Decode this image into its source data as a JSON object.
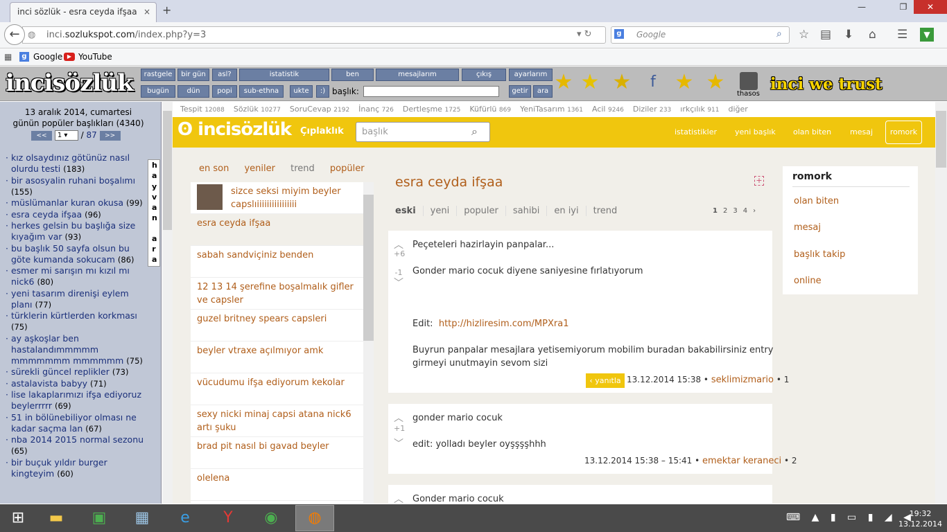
{
  "browser": {
    "tab_title": "inci sözlük - esra ceyda ifşaa",
    "tab_close": "×",
    "new_tab": "+",
    "url_prefix": "inci.",
    "url_domain": "sozlukspot.com",
    "url_path": "/index.php?y=3",
    "search_placeholder": "Google",
    "bookmarks": [
      "Google",
      "YouTube"
    ]
  },
  "site_header": {
    "logo": "incisözlük",
    "row1": [
      "rastgele",
      "bir gün",
      "asl?",
      "istatistik",
      "ben",
      "mesajlarım",
      "çıkış",
      "ayarlarım"
    ],
    "row2": [
      "bugün",
      "dün",
      "popi",
      "sub-ethna",
      "ukte",
      ":)"
    ],
    "baslik_label": "başlık:",
    "getir": "getir",
    "ara": "ara",
    "user": "thasos",
    "slogan": "inci we trust"
  },
  "sidebar": {
    "date": "13 aralık 2014, cumartesi",
    "popular": "günün popüler başlıkları (4340)",
    "prev": "<<",
    "page": "1",
    "sep": "/",
    "total": "87",
    "next": ">>",
    "vertical1": "h a y v a n",
    "vertical2": "a r a",
    "topics": [
      {
        "t": "kız olsaydınız götünüz nasıl olurdu testi",
        "c": "(183)"
      },
      {
        "t": "bir asosyalin ruhani boşalımı",
        "c": "(155)"
      },
      {
        "t": "müslümanlar kuran okusa",
        "c": "(99)"
      },
      {
        "t": "esra ceyda ifşaa",
        "c": "(96)"
      },
      {
        "t": "herkes gelsin bu başlığa size kıyağım var",
        "c": "(93)"
      },
      {
        "t": "bu başlık 50 sayfa olsun bu göte kumanda sokucam",
        "c": "(86)"
      },
      {
        "t": "esmer mi sarışın mı kızıl mı nick6",
        "c": "(80)"
      },
      {
        "t": "yeni tasarım direnişi eylem planı",
        "c": "(77)"
      },
      {
        "t": "türklerin kürtlerden korkması",
        "c": "(75)"
      },
      {
        "t": "ay aşkoşlar ben hastalandımmmmm mmmmmmm mmmmmm",
        "c": "(75)"
      },
      {
        "t": "sürekli güncel replikler",
        "c": "(73)"
      },
      {
        "t": "astalavista babyy",
        "c": "(71)"
      },
      {
        "t": "lise lakaplarımızı ifşa ediyoruz beylerrrrr",
        "c": "(69)"
      },
      {
        "t": "51 in bölünebiliyor olması ne kadar saçma lan",
        "c": "(67)"
      },
      {
        "t": "nba 2014 2015 normal sezonu",
        "c": "(65)"
      },
      {
        "t": "bir buçuk yıldır burger kingteyim",
        "c": "(60)"
      }
    ]
  },
  "categories": [
    {
      "n": "Tespit",
      "c": "12088"
    },
    {
      "n": "Sözlük",
      "c": "10277"
    },
    {
      "n": "SoruCevap",
      "c": "2192"
    },
    {
      "n": "İnanç",
      "c": "726"
    },
    {
      "n": "Dertleşme",
      "c": "1725"
    },
    {
      "n": "Küfürlü",
      "c": "869"
    },
    {
      "n": "YeniTasarım",
      "c": "1361"
    },
    {
      "n": "Acil",
      "c": "9246"
    },
    {
      "n": "Diziler",
      "c": "233"
    },
    {
      "n": "ırkçılık",
      "c": "911"
    },
    {
      "n": "diğer",
      "c": ""
    }
  ],
  "yellowbar": {
    "logo": "incisözlük",
    "cipla": "Çıplaklık",
    "search_placeholder": "başlık",
    "links": [
      "istatistikler",
      "yeni başlık",
      "olan biten",
      "mesaj"
    ],
    "romork": "romork"
  },
  "left_tabs": [
    "en son",
    "yeniler",
    "trend",
    "popüler"
  ],
  "left_list": [
    "sizce seksi miyim beyler capslıiiiiiiiiiiiiiiii",
    "esra ceyda ifşaa",
    "sabah sandviçiniz benden",
    "12 13 14 şerefine boşalmalık gifler ve capsler",
    "guzel britney spears capsleri",
    "beyler vtraxe açılmıyor amk",
    "vücudumu ifşa ediyorum kekolar",
    "sexy nicki minaj capsi atana nick6 artı şuku",
    "brad pit nasıl bi gavad beyler",
    "olelena"
  ],
  "main": {
    "title": "esra ceyda ifşaa",
    "plus": "+",
    "tabs": [
      "eski",
      "yeni",
      "populer",
      "sahibi",
      "en iyi",
      "trend"
    ],
    "pages": [
      "1",
      "2",
      "3",
      "4",
      "›"
    ],
    "entries": [
      {
        "up": "+6",
        "down": "-1",
        "line1": "Peçeteleri hazirlayin panpalar...",
        "line2": "Gonder mario cocuk diyene saniyesine fırlatıyorum",
        "edit_label": "Edit:",
        "link": "http://hizliresim.com/MPXra1",
        "line3": "Buyrun panpalar mesajlara yetisemiyorum mobilim buradan bakabilirsiniz entry",
        "line4": "girmeyi unutmayin sevom sizi",
        "reply": "‹ yanıtla",
        "date": "13.12.2014 15:38 •",
        "author": "seklimizmario",
        "num": "• 1"
      },
      {
        "up": "+1",
        "line1": "gonder mario cocuk",
        "line2": "edit: yolladı beyler oyşşşşhhh",
        "date": "13.12.2014 15:38 – 15:41 •",
        "author": "emektar keraneci",
        "num": "• 2"
      },
      {
        "line1": "Gonder mario cocuk"
      }
    ]
  },
  "right_box": {
    "title": "romork",
    "links": [
      "olan biten",
      "mesaj",
      "başlık takip",
      "online"
    ]
  },
  "taskbar": {
    "time": "19:32",
    "date": "13.12.2014"
  }
}
